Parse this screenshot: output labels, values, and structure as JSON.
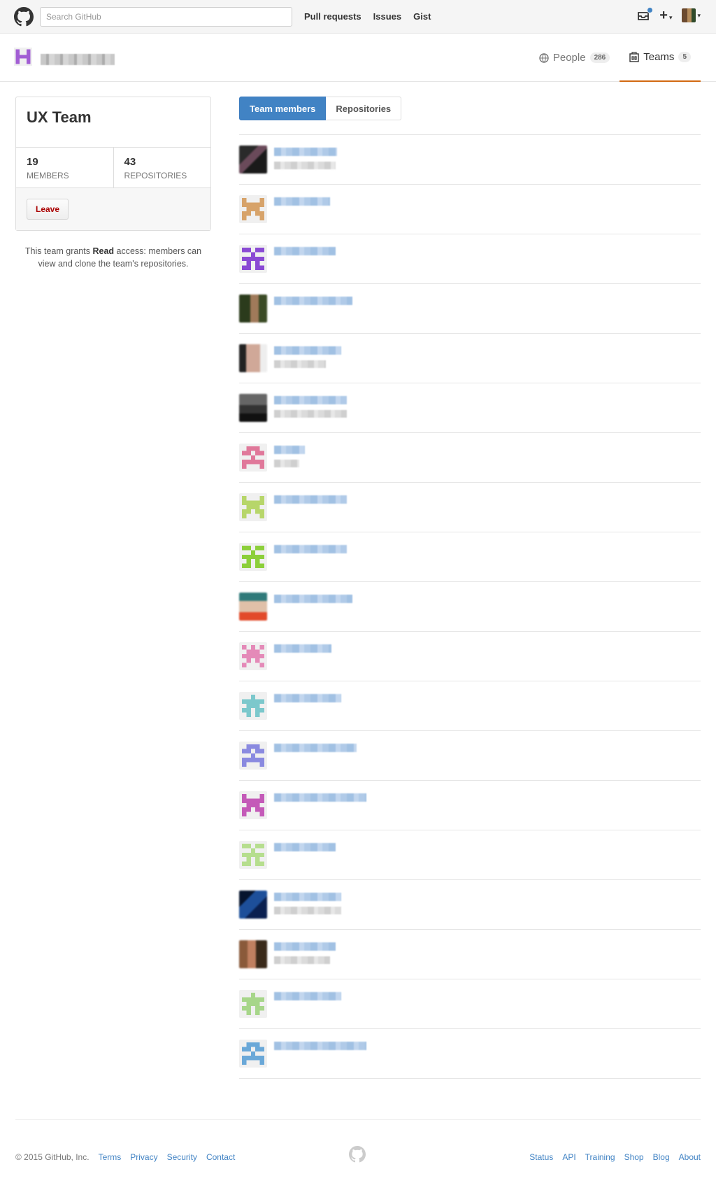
{
  "header": {
    "search_placeholder": "Search GitHub",
    "nav": [
      "Pull requests",
      "Issues",
      "Gist"
    ],
    "icons": [
      "github-logo-icon",
      "inbox-icon",
      "plus-icon",
      "avatar-icon"
    ]
  },
  "org": {
    "tabs": [
      {
        "label": "People",
        "count": "286",
        "icon": "people-icon"
      },
      {
        "label": "Teams",
        "count": "5",
        "icon": "teams-icon",
        "selected": true
      }
    ]
  },
  "team": {
    "name": "UX Team",
    "members_count": "19",
    "members_label": "MEMBERS",
    "repos_count": "43",
    "repos_label": "REPOSITORIES",
    "leave_label": "Leave",
    "note_prefix": "This team grants ",
    "note_bold": "Read",
    "note_suffix": " access: members can view and clone the team's repositories."
  },
  "subnav": {
    "members_label": "Team members",
    "repos_label": "Repositories"
  },
  "members": [
    {
      "avatar": "photo-dark",
      "has_subtitle": true
    },
    {
      "avatar": "identicon-tan",
      "has_subtitle": false
    },
    {
      "avatar": "identicon-purple",
      "has_subtitle": false
    },
    {
      "avatar": "photo-green",
      "has_subtitle": false
    },
    {
      "avatar": "photo-face",
      "has_subtitle": true
    },
    {
      "avatar": "photo-gray",
      "has_subtitle": true
    },
    {
      "avatar": "identicon-pink",
      "has_subtitle": true
    },
    {
      "avatar": "identicon-lime",
      "has_subtitle": false
    },
    {
      "avatar": "identicon-green",
      "has_subtitle": false
    },
    {
      "avatar": "photo-teal",
      "has_subtitle": false
    },
    {
      "avatar": "identicon-rose",
      "has_subtitle": false
    },
    {
      "avatar": "identicon-cyan",
      "has_subtitle": false
    },
    {
      "avatar": "identicon-lavender",
      "has_subtitle": false
    },
    {
      "avatar": "identicon-magenta",
      "has_subtitle": false
    },
    {
      "avatar": "identicon-lightgreen",
      "has_subtitle": false
    },
    {
      "avatar": "photo-blue",
      "has_subtitle": true
    },
    {
      "avatar": "photo-brown",
      "has_subtitle": true
    },
    {
      "avatar": "identicon-mint",
      "has_subtitle": false
    },
    {
      "avatar": "identicon-skyblue",
      "has_subtitle": false
    }
  ],
  "footer": {
    "copyright": "© 2015 GitHub, Inc.",
    "left_links": [
      "Terms",
      "Privacy",
      "Security",
      "Contact"
    ],
    "right_links": [
      "Status",
      "API",
      "Training",
      "Shop",
      "Blog",
      "About"
    ]
  }
}
